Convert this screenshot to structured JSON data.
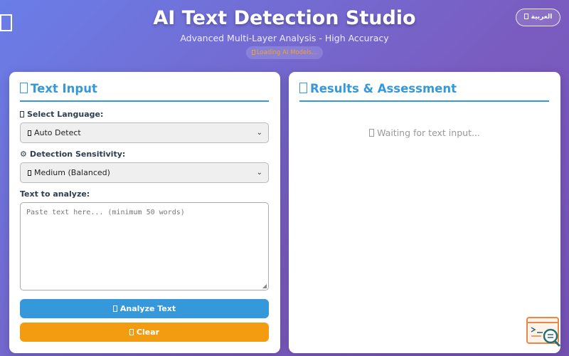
{
  "header": {
    "title": "AI Text Detection Studio",
    "subtitle": "Advanced Multi-Layer Analysis - High Accuracy",
    "loading_status": "Loading AI Models...",
    "language_toggle": "العربية"
  },
  "input_panel": {
    "title": "Text Input",
    "language_label": "Select Language:",
    "language_selected": "Auto Detect",
    "sensitivity_label": "Detection Sensitivity:",
    "sensitivity_icon": "⚙",
    "sensitivity_selected": "Medium (Balanced)",
    "text_label": "Text to analyze:",
    "text_placeholder": "Paste text here... (minimum 50 words)",
    "analyze_label": "Analyze Text",
    "clear_label": "Clear"
  },
  "results_panel": {
    "title": "Results & Assessment",
    "waiting_text": "Waiting for text input..."
  },
  "colors": {
    "accent": "#3498db",
    "clear_button": "#f39c12",
    "background_start": "#6a7ee8",
    "background_end": "#7452b4"
  }
}
